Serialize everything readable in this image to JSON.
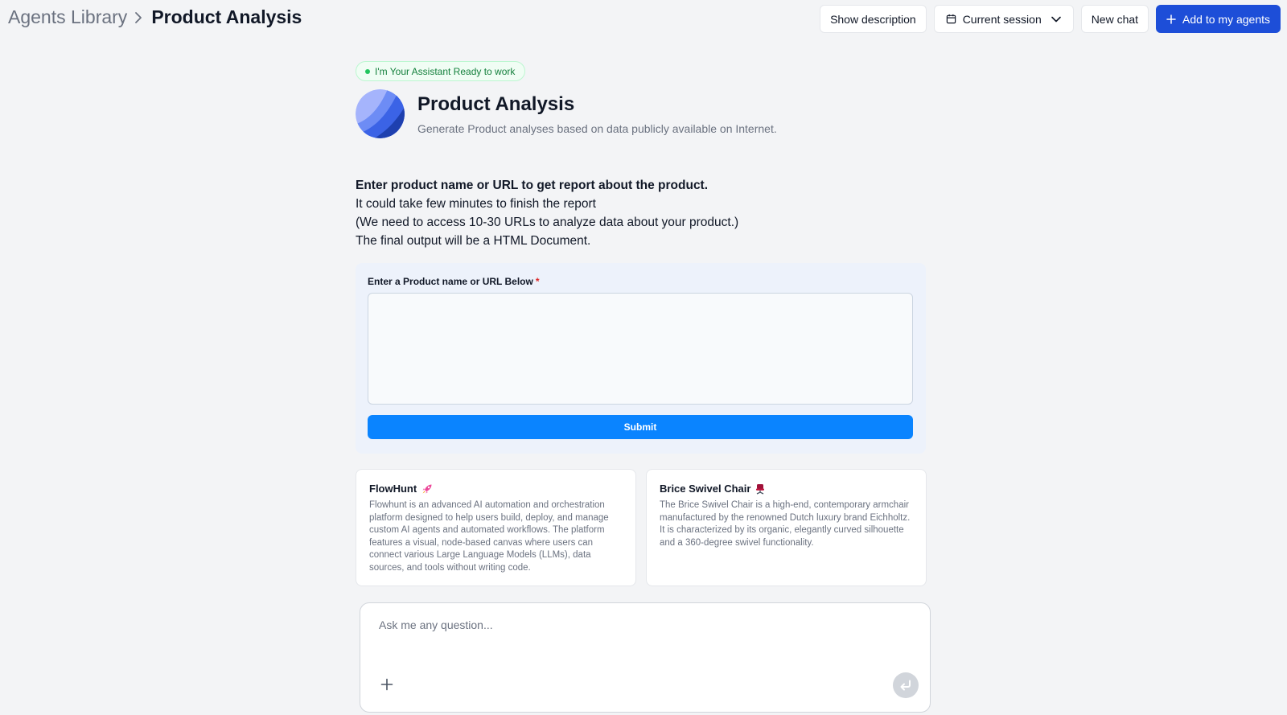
{
  "breadcrumb": {
    "parent": "Agents Library",
    "current": "Product Analysis"
  },
  "header": {
    "show_description": "Show description",
    "session": "Current session",
    "new_chat": "New chat",
    "add_agents": "Add to my agents"
  },
  "status": {
    "label": "I'm Your Assistant Ready to work",
    "color": "#22c55e"
  },
  "agent": {
    "title": "Product Analysis",
    "description": "Generate Product analyses based on data publicly available on Internet."
  },
  "intro": {
    "line1": "Enter product name or URL to get report about the product.",
    "line2": "It could take few minutes to finish the report",
    "line3": "(We need to access 10-30 URLs to analyze data about your product.)",
    "line4": "The final output will be a HTML Document."
  },
  "form": {
    "label": "Enter a Product name or URL Below",
    "required_mark": "*",
    "value": "",
    "submit": "Submit"
  },
  "suggestions": [
    {
      "title": "FlowHunt",
      "icon": "rocket-icon",
      "body": "Flowhunt is an advanced AI automation and orchestration platform designed to help users build, deploy, and manage custom AI agents and automated workflows. The platform features a visual, node-based canvas where users can connect various Large Language Models (LLMs), data sources, and tools without writing code."
    },
    {
      "title": "Brice Swivel Chair",
      "icon": "chair-icon",
      "body": "The Brice Swivel Chair is a high-end, contemporary armchair manufactured by the renowned Dutch luxury brand Eichholtz. It is characterized by its organic, elegantly curved silhouette and a 360-degree swivel functionality."
    }
  ],
  "chat": {
    "placeholder": "Ask me any question..."
  },
  "colors": {
    "primary": "#1d4ed8",
    "submit": "#0a84ff",
    "background": "#f3f4f6"
  }
}
